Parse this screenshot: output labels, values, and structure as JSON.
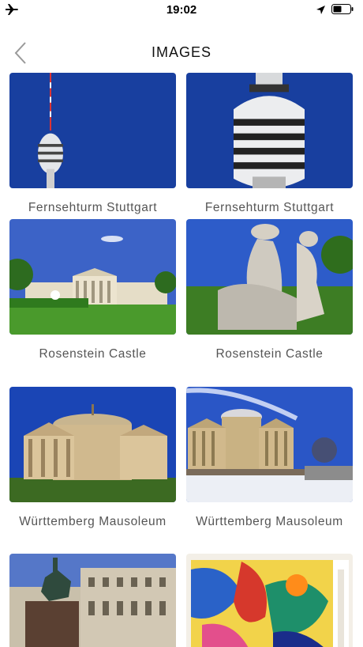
{
  "status_bar": {
    "time": "19:02"
  },
  "nav": {
    "title": "IMAGES"
  },
  "images": [
    {
      "caption": "Fernsehturm Stuttgart"
    },
    {
      "caption": "Fernsehturm Stuttgart"
    },
    {
      "caption": "Rosenstein Castle"
    },
    {
      "caption": "Rosenstein Castle"
    },
    {
      "caption": "Württemberg Mausoleum"
    },
    {
      "caption": "Württemberg Mausoleum"
    },
    {
      "caption": ""
    },
    {
      "caption": ""
    }
  ],
  "icons": [
    "airplane-mode-icon",
    "location-arrow-icon",
    "battery-icon",
    "back-chevron-icon"
  ],
  "colors": {
    "sky": "#1c48a6",
    "caption": "#555555",
    "background": "#ffffff"
  }
}
